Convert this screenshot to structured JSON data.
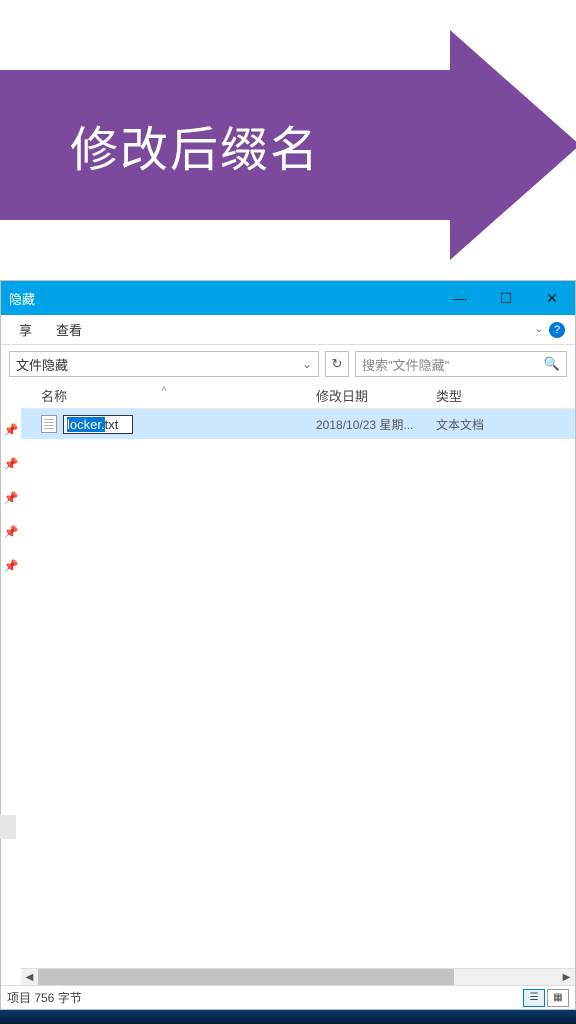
{
  "banner": {
    "text": "修改后缀名"
  },
  "titlebar": {
    "title": "隐藏"
  },
  "menu": {
    "share": "享",
    "view": "查看"
  },
  "path": {
    "folder": "文件隐藏",
    "search_placeholder": "搜索\"文件隐藏\"",
    "refresh": "↻"
  },
  "columns": {
    "name": "名称",
    "date": "修改日期",
    "type": "类型"
  },
  "file": {
    "name_sel": "locker.",
    "name_ext": "txt",
    "date": "2018/10/23 星期...",
    "type": "文本文档"
  },
  "status": {
    "text": "项目  756 字节"
  }
}
